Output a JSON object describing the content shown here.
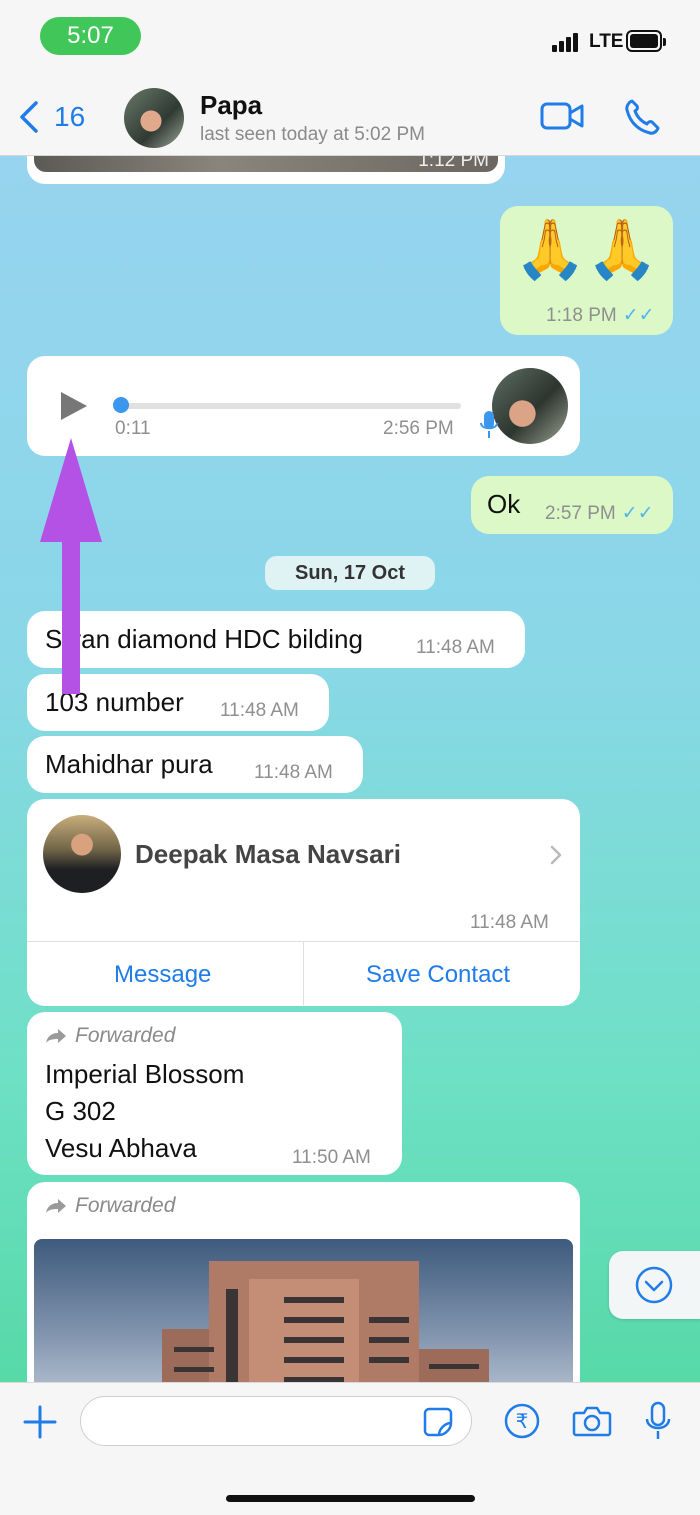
{
  "status_bar": {
    "time": "5:07",
    "network": "LTE"
  },
  "header": {
    "back_count": "16",
    "contact_name": "Papa",
    "last_seen": "last seen today at 5:02 PM",
    "icons": [
      "chevron-left-icon",
      "video-call-icon",
      "phone-icon"
    ]
  },
  "messages": {
    "top_image_time": "1:12 PM",
    "emoji": {
      "text": "🙏🙏",
      "time": "1:18 PM"
    },
    "voice": {
      "elapsed": "0:11",
      "time": "2:56 PM"
    },
    "ok": {
      "text": "Ok",
      "time": "2:57 PM"
    },
    "date_chip": "Sun, 17 Oct",
    "m1": {
      "text": "Sivan diamond HDC bilding",
      "time": "11:48 AM"
    },
    "m2": {
      "text": "103 number",
      "time": "11:48 AM"
    },
    "m3": {
      "text": "Mahidhar pura",
      "time": "11:48 AM"
    },
    "contact_card": {
      "name": "Deepak Masa Navsari",
      "time": "11:48 AM",
      "message_label": "Message",
      "save_label": "Save Contact"
    },
    "fwd1": {
      "label": "Forwarded",
      "line1": "Imperial Blossom",
      "line2": "G 302",
      "line3": "Vesu Abhava",
      "time": "11:50 AM"
    },
    "fwd2": {
      "label": "Forwarded"
    }
  },
  "colors": {
    "accent": "#1f7ce8",
    "outgoing_bubble": "#dcf8c6",
    "arrow": "#b452e6",
    "status_pill": "#41c759"
  }
}
